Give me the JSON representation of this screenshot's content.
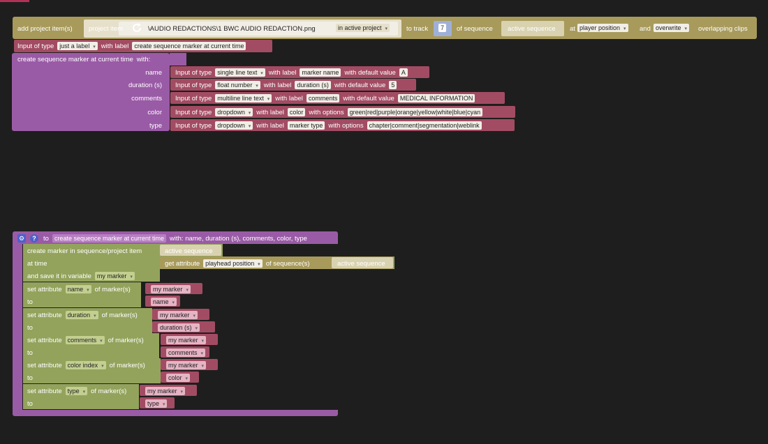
{
  "colors": {
    "background": "#1e1e1e",
    "tan_block": "#a89a5b",
    "purple_block": "#9a5ba6",
    "maroon_block": "#a24c63",
    "green_block": "#93a35c",
    "accent_tab": "#b13257"
  },
  "top_block": {
    "add_label": "add project item(s)",
    "project_item_label": "project item",
    "path": "\\AUDIO REDACTIONS\\1 BWC AUDIO REDACTION.png",
    "scope": "in active project",
    "to_track_label": "to track",
    "track_value": "7",
    "of_sequence_label": "of sequence",
    "sequence_value": "active sequence",
    "at_label": "at",
    "position": "player position",
    "and_label": "and",
    "mode": "overwrite",
    "suffix": "overlapping clips"
  },
  "input_row": {
    "input_of_type": "Input of type",
    "type_value": "just a label",
    "with_label": "with label",
    "label_value": "create sequence marker at current time"
  },
  "call_block": {
    "title": "create sequence marker at current time",
    "with_label": "with:",
    "params": [
      {
        "name": "name",
        "input_of_type": "Input of type",
        "type": "single line text",
        "with_label": "with label",
        "label": "marker name",
        "extra_label": "with default value",
        "extra": "A"
      },
      {
        "name": "duration (s)",
        "input_of_type": "Input of type",
        "type": "float number",
        "with_label": "with label",
        "label": "duration (s)",
        "extra_label": "with default value",
        "extra": "5"
      },
      {
        "name": "comments",
        "input_of_type": "Input of type",
        "type": "multiline line text",
        "with_label": "with label",
        "label": "comments",
        "extra_label": "with default value",
        "extra": "MEDICAL INFORMATION"
      },
      {
        "name": "color",
        "input_of_type": "Input of type",
        "type": "dropdown",
        "with_label": "with label",
        "label": "color",
        "extra_label": "with options",
        "extra": "green|red|purple|orange|yellow|white|blue|cyan"
      },
      {
        "name": "type",
        "input_of_type": "Input of type",
        "type": "dropdown",
        "with_label": "with label",
        "label": "marker type",
        "extra_label": "with options",
        "extra": "chapter|comment|segmentation|weblink"
      }
    ]
  },
  "func_block": {
    "gear_glyph": "⚙",
    "help_glyph": "?",
    "to_label": "to",
    "func_name": "create sequence marker at current time",
    "params_text": "with: name, duration (s), comments, color, type",
    "create_label": "create marker in sequence/project item",
    "create_target": "active sequence",
    "at_time_label": "at time",
    "get_attribute_label": "get attribute",
    "attribute": "playhead position",
    "of_sequences_label": "of sequence(s)",
    "sequence_target": "active sequence",
    "save_label": "and save it in variable",
    "save_var": "my marker",
    "set_attribute_label": "set attribute",
    "of_markers_label": "of marker(s)",
    "to_label2": "to",
    "sets": [
      {
        "attr": "name",
        "marker": "my marker",
        "value": "name"
      },
      {
        "attr": "duration",
        "marker": "my marker",
        "value": "duration (s)"
      },
      {
        "attr": "comments",
        "marker": "my marker",
        "value": "comments"
      },
      {
        "attr": "color index",
        "marker": "my marker",
        "value": "color"
      },
      {
        "attr": "type",
        "marker": "my marker",
        "value": "type"
      }
    ]
  }
}
